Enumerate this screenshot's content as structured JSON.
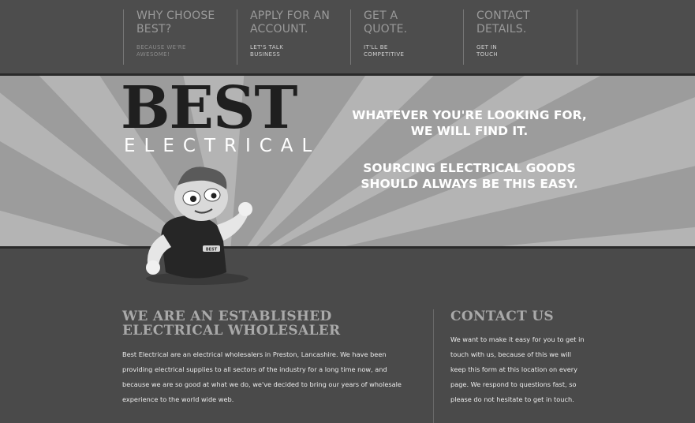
{
  "nav": {
    "items": [
      {
        "title": "Why choose\nbest?",
        "sub": "Because we're\nawesome!"
      },
      {
        "title": "Apply for an\naccount.",
        "sub": "Let's talk\nbusiness"
      },
      {
        "title": "Get a\nquote.",
        "sub": "It'll be\ncompetitive"
      },
      {
        "title": "Contact\ndetails.",
        "sub": "Get in\ntouch"
      }
    ]
  },
  "logo": {
    "main": "BEST",
    "sub": "ELECTRICAL",
    "badge": "BEST"
  },
  "hero": {
    "line1": "WHATEVER YOU'RE LOOKING FOR, WE WILL FIND IT.",
    "line2": "SOURCING ELECTRICAL GOODS SHOULD ALWAYS BE THIS EASY."
  },
  "about": {
    "title": "WE ARE AN ESTABLISHED ELECTRICAL WHOLESALER",
    "body": "Best Electrical are an electrical wholesalers in Preston, Lancashire. We have been providing electrical supplies to all sectors of the industry for a long time now, and because we are so good at what we do, we've decided to bring our years of wholesale experience to the world wide web."
  },
  "contact": {
    "title": "CONTACT US",
    "body": "We want to make it easy for you to get in touch with us, because of this we will keep this form at this location on every page. We respond to questions fast, so please do not hesitate to get in touch."
  }
}
